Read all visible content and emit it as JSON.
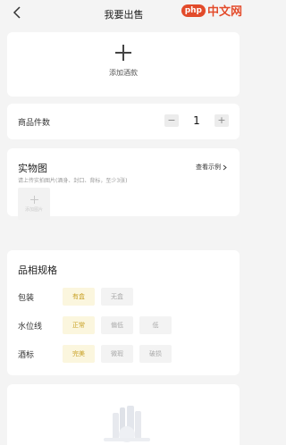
{
  "header": {
    "title": "我要出售",
    "watermark_badge": "php",
    "watermark_text": "中文网"
  },
  "add_wine": {
    "label": "添加酒款"
  },
  "quantity": {
    "label": "商品件数",
    "minus": "−",
    "plus": "+",
    "value": "1"
  },
  "photos": {
    "title": "实物图",
    "example_link": "查看示例",
    "hint": "请上传实拍图片(酒身、封口、背标，至少3张)",
    "upload_label": "添加图片"
  },
  "specs": {
    "title": "品相规格",
    "rows": [
      {
        "label": "包装",
        "options": [
          "有盒",
          "无盒"
        ],
        "selected": 0
      },
      {
        "label": "水位线",
        "options": [
          "正常",
          "偏低",
          "低"
        ],
        "selected": 0
      },
      {
        "label": "酒标",
        "options": [
          "完美",
          "微瑕",
          "破损"
        ],
        "selected": 0
      }
    ]
  },
  "colors": {
    "accent_gold": "#c9a227",
    "chip_active_bg": "#fbf6de",
    "watermark_red": "#e24b2b"
  }
}
